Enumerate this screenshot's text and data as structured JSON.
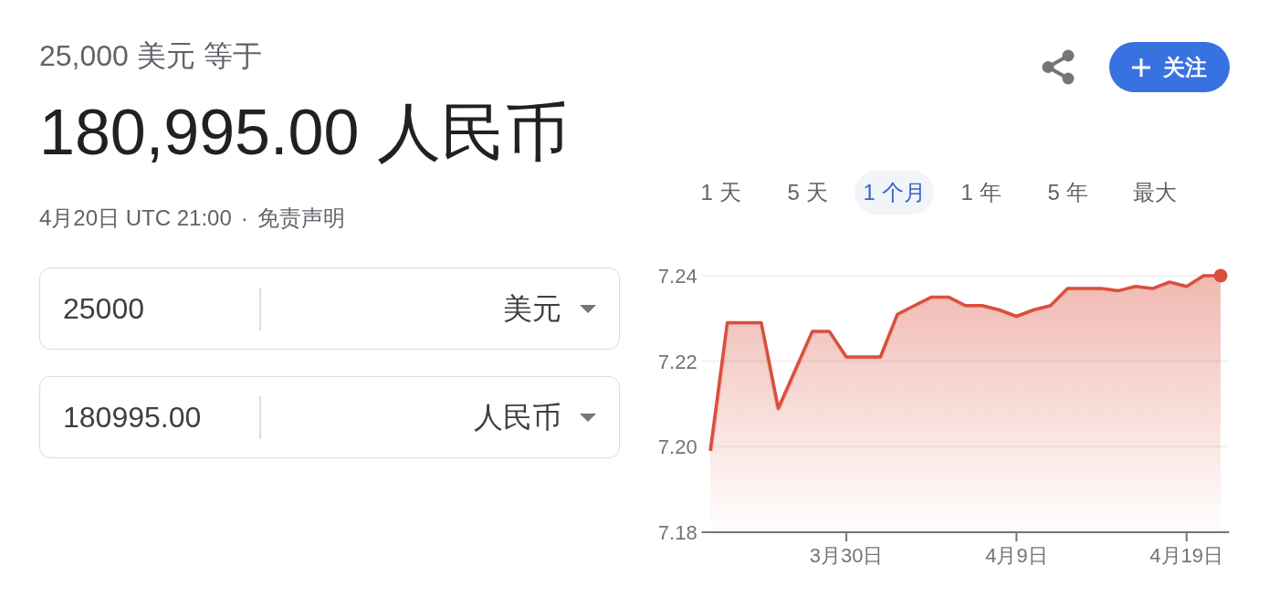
{
  "header": {
    "source_amount": "25,000 美元 等于",
    "result": "180,995.00 人民币",
    "updated": "4月20日 UTC 21:00",
    "separator": "·",
    "disclaimer_link": "免责声明"
  },
  "follow_button": {
    "label": "关注"
  },
  "converter": [
    {
      "amount": "25000",
      "currency": "美元"
    },
    {
      "amount": "180995.00",
      "currency": "人民币"
    }
  ],
  "range_tabs": [
    {
      "label": "1 天",
      "selected": false
    },
    {
      "label": "5 天",
      "selected": false
    },
    {
      "label": "1 个月",
      "selected": true
    },
    {
      "label": "1 年",
      "selected": false
    },
    {
      "label": "5 年",
      "selected": false
    },
    {
      "label": "最大",
      "selected": false
    }
  ],
  "chart": {
    "chart_data": {
      "type": "area",
      "categories": [
        null,
        null,
        null,
        null,
        null,
        null,
        null,
        null,
        "3月30日",
        null,
        null,
        null,
        null,
        null,
        null,
        null,
        null,
        null,
        "4月9日",
        null,
        null,
        null,
        null,
        null,
        null,
        null,
        null,
        null,
        "4月19日",
        null,
        null
      ],
      "series": [
        {
          "color": "#d94f3d",
          "values": [
            7.199,
            7.229,
            7.229,
            7.229,
            7.209,
            7.218,
            7.227,
            7.227,
            7.221,
            7.221,
            7.221,
            7.231,
            7.233,
            7.235,
            7.235,
            7.233,
            7.233,
            7.232,
            7.2305,
            7.232,
            7.233,
            7.237,
            7.237,
            7.237,
            7.2365,
            7.2375,
            7.237,
            7.2385,
            7.2375,
            7.24,
            7.24
          ]
        }
      ],
      "ylim": [
        7.18,
        7.24
      ],
      "yticks": [
        {
          "value": 7.18,
          "label": "7.18"
        },
        {
          "value": 7.2,
          "label": "7.20"
        },
        {
          "value": 7.22,
          "label": "7.22"
        },
        {
          "value": 7.24,
          "label": "7.24"
        }
      ]
    }
  }
}
